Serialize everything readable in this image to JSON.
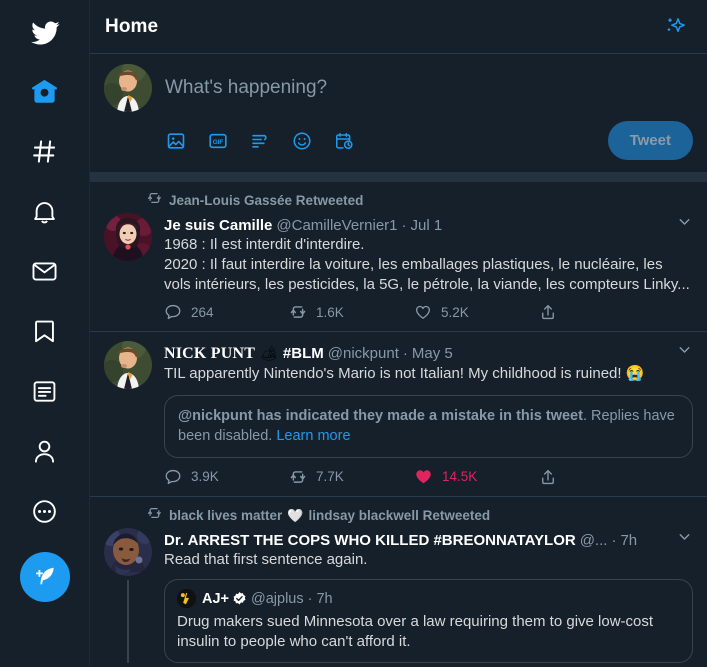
{
  "nav": {
    "items": [
      {
        "name": "twitter-logo",
        "label": "Twitter"
      },
      {
        "name": "home",
        "label": "Home",
        "active": true
      },
      {
        "name": "explore",
        "label": "Explore"
      },
      {
        "name": "notifications",
        "label": "Notifications"
      },
      {
        "name": "messages",
        "label": "Messages"
      },
      {
        "name": "bookmarks",
        "label": "Bookmarks"
      },
      {
        "name": "lists",
        "label": "Lists"
      },
      {
        "name": "profile",
        "label": "Profile"
      },
      {
        "name": "more",
        "label": "More"
      }
    ],
    "compose_label": "Tweet"
  },
  "header": {
    "title": "Home",
    "sparkle_label": "Top Tweets"
  },
  "compose": {
    "placeholder": "What's happening?",
    "tweet_label": "Tweet",
    "icons": [
      "image-icon",
      "gif-icon",
      "poll-icon",
      "emoji-icon",
      "schedule-icon"
    ]
  },
  "colors": {
    "background": "#15202b",
    "accent": "#1d9bf0",
    "like": "#e0245e",
    "muted": "#8899a6",
    "border": "#293b4a",
    "separator": "#253341"
  },
  "tweets": [
    {
      "retweet_context": "Jean-Louis Gassée Retweeted",
      "display_name": "Je suis Camille",
      "handle": "@CamilleVernier1",
      "dot": "·",
      "time": "Jul 1",
      "text": "1968 : Il est interdit d'interdire.\n2020 : Il faut interdire la voiture, les emballages plastiques, le nucléaire, les vols intérieurs, les pesticides, la 5G, le pétrole, la viande, les compteurs Linky...",
      "actions": {
        "replies": "264",
        "retweets": "1.6K",
        "likes": "5.2K",
        "liked": false
      }
    },
    {
      "retweet_context": null,
      "display_name": "NICK PUNT",
      "name_emoji": "🏕",
      "name_suffix": "#BLM",
      "handle": "@nickpunt",
      "dot": "·",
      "time": "May 5",
      "text": "TIL apparently Nintendo's Mario is not Italian! My childhood is ruined! 😭",
      "notice": {
        "bold": "@nickpunt has indicated they made a mistake in this tweet",
        "rest": ". Replies have been disabled. ",
        "link": "Learn more"
      },
      "actions": {
        "replies": "3.9K",
        "retweets": "7.7K",
        "likes": "14.5K",
        "liked": true
      }
    },
    {
      "retweet_context_pre": "black lives matter",
      "retweet_context_emoji": "🤍",
      "retweet_context_post": "lindsay blackwell Retweeted",
      "display_name": "Dr. ARREST THE COPS WHO KILLED #BREONNATAYLOR",
      "handle": "@...",
      "dot": "·",
      "time": "7h",
      "text": "Read that first sentence again.",
      "quote": {
        "name": "AJ+",
        "verified": true,
        "handle": "@ajplus",
        "dot": "·",
        "time": "7h",
        "text": "Drug makers sued Minnesota over a law requiring them to give low-cost insulin to people who can't afford it."
      }
    }
  ]
}
